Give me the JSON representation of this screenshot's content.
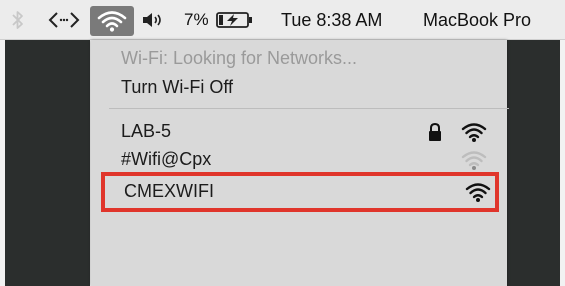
{
  "menubar": {
    "status_title": "Wi-Fi: Looking for Networks...",
    "battery_percent": "7%",
    "datetime": "Tue 8:38 AM",
    "computer_name": "MacBook Pro",
    "icons": [
      "bluetooth-icon",
      "code-brackets-icon",
      "wifi-icon",
      "volume-icon",
      "battery-charging-icon"
    ]
  },
  "wifi_menu": {
    "status": "Wi-Fi: Looking for Networks...",
    "toggle_label": "Turn Wi-Fi Off",
    "networks": [
      {
        "name": "LAB-5",
        "locked": true,
        "signal": "strong"
      },
      {
        "name": "#Wifi@Cpx",
        "locked": false,
        "signal": "weak"
      },
      {
        "name": "CMEXWIFI",
        "locked": false,
        "signal": "strong",
        "highlighted": true
      }
    ],
    "highlight_color": "#e0352b"
  }
}
